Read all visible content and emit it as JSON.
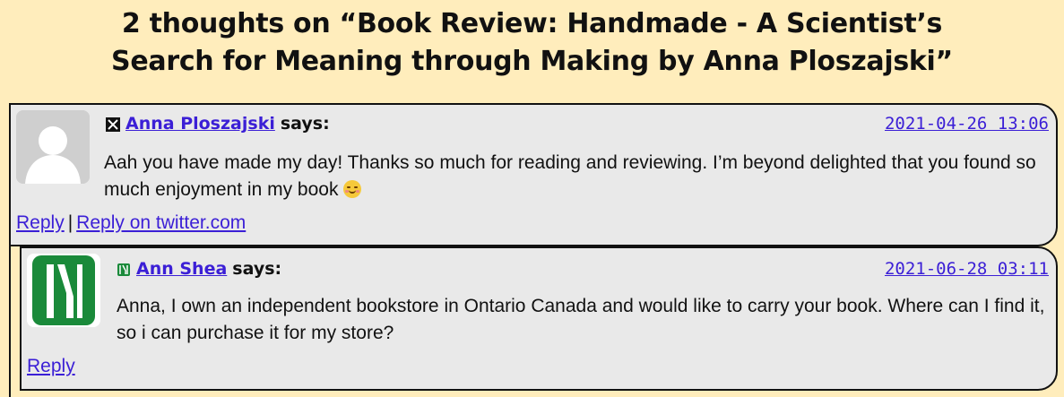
{
  "page": {
    "heading_line1": "2 thoughts on “Book Review: Handmade - A Scientist’s",
    "heading_line2": "Search for Meaning through Making by Anna Ploszajski”"
  },
  "comments": [
    {
      "source_icon": "x-twitter-icon",
      "author": "Anna Ploszajski",
      "says": "says:",
      "date": "2021-04-26 13:06",
      "text": "Aah you have made my day! Thanks so much for reading and reviewing. I’m beyond delighted that you found so much enjoyment in my book",
      "emoji": "smiling-blush-emoji",
      "reply_label": "Reply",
      "separator": "|",
      "reply_twitter_label": "Reply on twitter.com"
    },
    {
      "source_icon": "site-logo-icon",
      "author": "Ann Shea",
      "says": "says:",
      "date": "2021-06-28 03:11",
      "text": "Anna, I own an independent bookstore in Ontario Canada and would like to carry your book. Where can I find it, so i can purchase it for my store?",
      "reply_label": "Reply"
    }
  ],
  "colors": {
    "background": "#ffedbc",
    "card": "#e9e9e9",
    "link": "#3b1fd6",
    "logo_green": "#1a8a3a"
  }
}
